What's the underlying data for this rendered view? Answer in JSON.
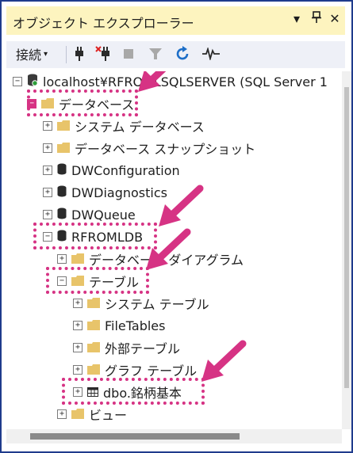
{
  "panel": {
    "title": "オブジェクト エクスプローラー",
    "controls": {
      "dropdown": "▾",
      "pin": "ᛘ",
      "close": "✕"
    }
  },
  "toolbar": {
    "connect_label": "接続",
    "caret": "▾"
  },
  "tree": {
    "nodes": [
      {
        "label": "localhost¥RFROMLSQLSERVER (SQL Server 1",
        "expander": "−"
      },
      {
        "label": "データベース",
        "expander": "−"
      },
      {
        "label": "システム データベース",
        "expander": "+"
      },
      {
        "label": "データベース スナップショット",
        "expander": "+"
      },
      {
        "label": "DWConfiguration",
        "expander": "+"
      },
      {
        "label": "DWDiagnostics",
        "expander": "+"
      },
      {
        "label": "DWQueue",
        "expander": "+"
      },
      {
        "label": "RFROMLDB",
        "expander": "−"
      },
      {
        "label": "データベース ダイアグラム",
        "expander": "+"
      },
      {
        "label": "テーブル",
        "expander": "−"
      },
      {
        "label": "システム テーブル",
        "expander": "+"
      },
      {
        "label": "FileTables",
        "expander": "+"
      },
      {
        "label": "外部テーブル",
        "expander": "+"
      },
      {
        "label": "グラフ テーブル",
        "expander": "+"
      },
      {
        "label": "dbo.銘柄基本",
        "expander": "+"
      },
      {
        "label": "ビュー",
        "expander": "+"
      }
    ]
  },
  "colors": {
    "highlight": "#d63384",
    "title_bg": "#fdf4bf",
    "frame": "#1f3b8c",
    "folder": "#e8c46a"
  }
}
